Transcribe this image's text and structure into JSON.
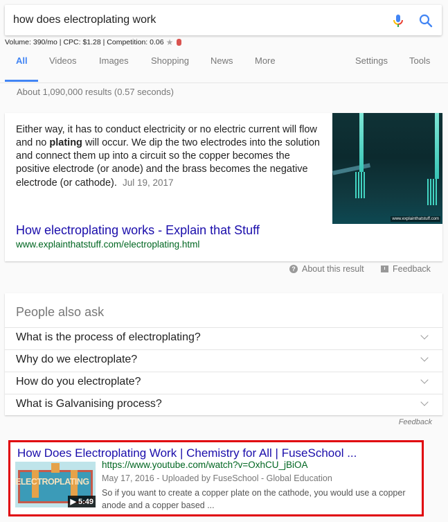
{
  "search": {
    "query": "how does electroplating work",
    "mic_icon": "microphone-icon",
    "search_icon": "search-icon"
  },
  "keyword_stats": {
    "text": "Volume: 390/mo | CPC: $1.28 | Competition: 0.06",
    "star_icon": "★"
  },
  "tabs": [
    {
      "label": "All",
      "active": true
    },
    {
      "label": "Videos"
    },
    {
      "label": "Images"
    },
    {
      "label": "Shopping"
    },
    {
      "label": "News"
    },
    {
      "label": "More"
    },
    {
      "label": "Settings"
    },
    {
      "label": "Tools"
    }
  ],
  "results_stats": "About 1,090,000 results (0.57 seconds)",
  "featured_snippet": {
    "text_before": "Either way, it has to conduct electricity or no electric current will flow and no ",
    "bold": "plating",
    "text_after": " will occur. We dip the two electrodes into the solution and connect them up into a circuit so the copper becomes the positive electrode (or anode) and the brass becomes the negative electrode (or cathode).",
    "date": "Jul 19, 2017",
    "image_watermark": "www.explainthatstuff.com",
    "title": "How electroplating works - Explain that Stuff",
    "url": "www.explainthatstuff.com/electroplating.html"
  },
  "snippet_footer": {
    "about_label": "About this result",
    "feedback_label": "Feedback"
  },
  "people_also_ask": {
    "heading": "People also ask",
    "questions": [
      "What is the process of electroplating?",
      "Why do we electroplate?",
      "How do you electroplate?",
      "What is Galvanising process?"
    ],
    "feedback_label": "Feedback"
  },
  "video_result": {
    "title": "How Does Electroplating Work | Chemistry for All | FuseSchool ...",
    "url": "https://www.youtube.com/watch?v=OxhCU_jBiOA",
    "meta": "May 17, 2016 - Uploaded by FuseSchool - Global Education",
    "description": "So if you want to create a copper plate on the cathode, you would use a copper anode and a copper based ...",
    "thumbnail_label": "ELECTROPLATING",
    "duration": "▶ 5:49",
    "highlight_color": "#e0000a"
  }
}
